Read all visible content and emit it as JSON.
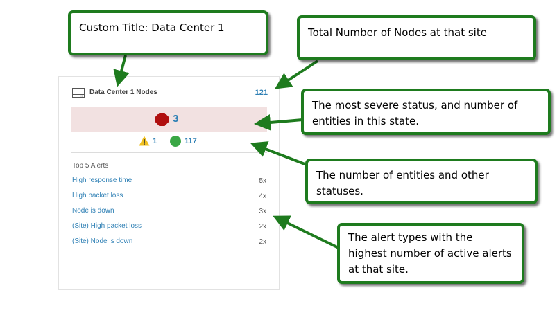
{
  "widget": {
    "title": "Data Center 1 Nodes",
    "total_nodes": "121",
    "severe_count": "3",
    "warning_count": "1",
    "ok_count": "117",
    "alerts_title": "Top 5 Alerts",
    "alerts": [
      {
        "name": "High response time",
        "count": "5x"
      },
      {
        "name": "High packet loss",
        "count": "4x"
      },
      {
        "name": "Node is down",
        "count": "3x"
      },
      {
        "name": "(Site) High packet loss",
        "count": "2x"
      },
      {
        "name": "(Site) Node is down",
        "count": "2x"
      }
    ]
  },
  "callouts": {
    "title": "Custom Title: Data Center 1",
    "total": "Total Number of Nodes at that site",
    "severe": "The most severe status, and number of entities in this state.",
    "entities": "The number of entities and other statuses.",
    "alerts": "The alert types with the highest number of active alerts at that site."
  },
  "colors": {
    "link": "#2f80b5",
    "severe_band": "#f2e1e1",
    "critical": "#b01010",
    "warning": "#f0c020",
    "ok": "#3aa745",
    "callout_border": "#1e7b1e"
  },
  "icons": {
    "header": "server-icon",
    "severe": "critical-stop-icon",
    "warning": "warning-triangle-icon",
    "ok": "ok-circle-icon"
  }
}
